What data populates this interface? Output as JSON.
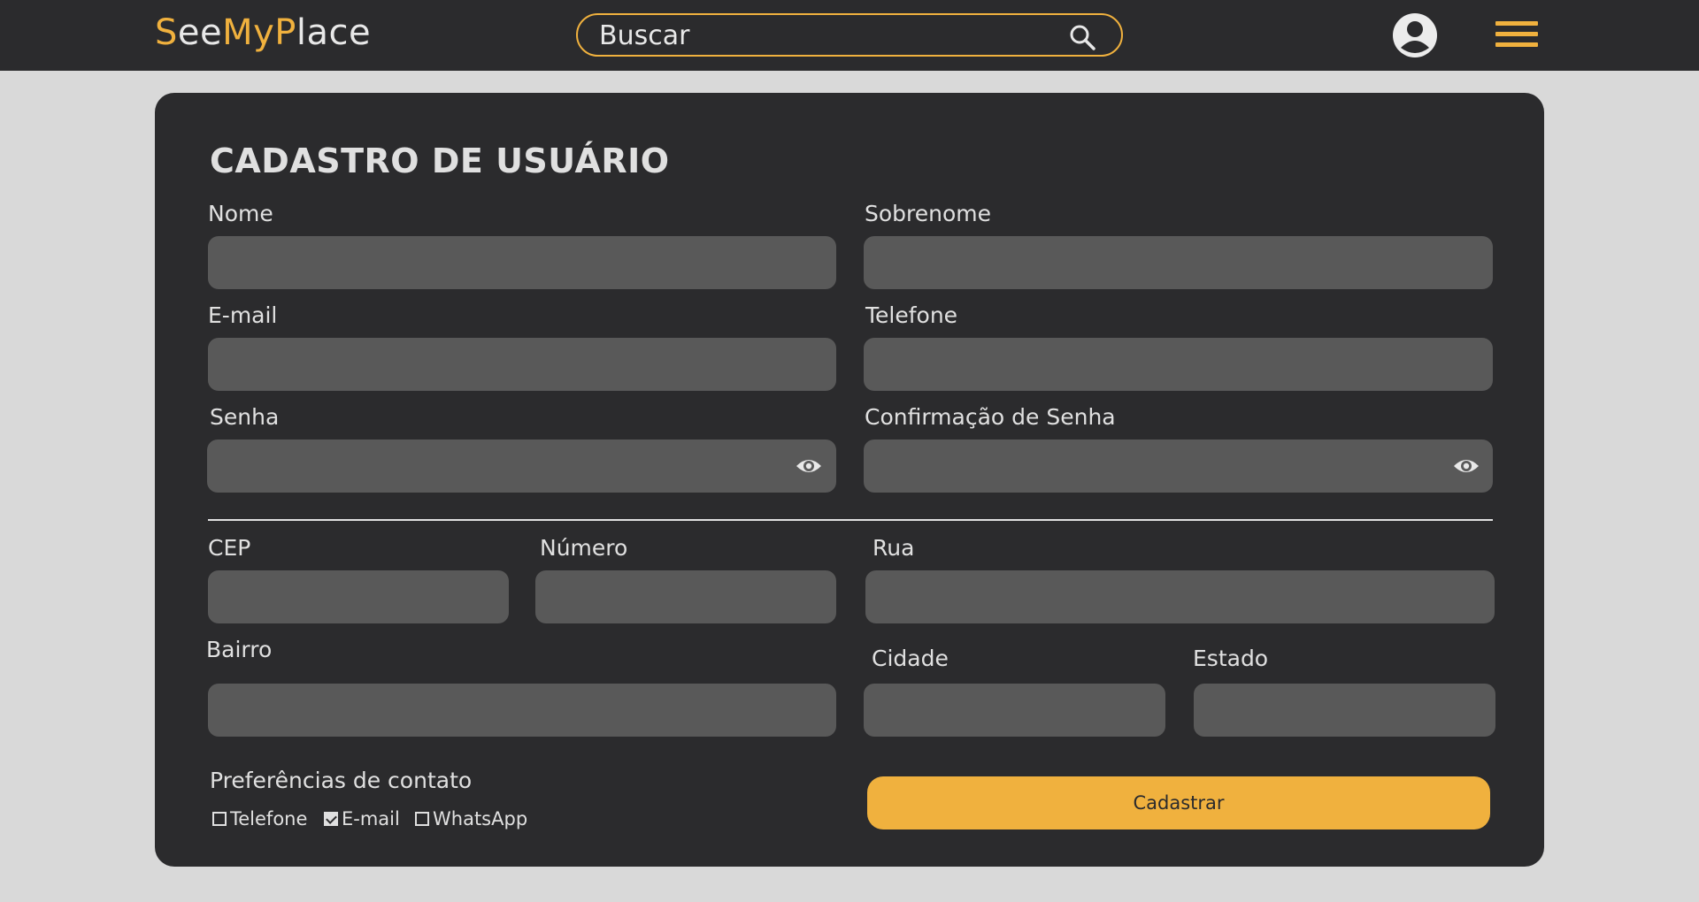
{
  "header": {
    "logo": {
      "part1": "S",
      "part2": "ee",
      "part3": "My",
      "part4": "P",
      "part5": "lace"
    },
    "search": {
      "placeholder": "Buscar",
      "icon": "search-icon"
    },
    "user_icon": "user-avatar-icon",
    "menu_icon": "hamburger-menu-icon"
  },
  "colors": {
    "accent": "#f0b13e",
    "card": "#2b2b2d",
    "field": "#595959",
    "page": "#d9d9d9"
  },
  "form": {
    "title": "CADASTRO DE USUÁRIO",
    "fields": {
      "nome": {
        "label": "Nome",
        "value": ""
      },
      "sobrenome": {
        "label": "Sobrenome",
        "value": ""
      },
      "email": {
        "label": "E-mail",
        "value": ""
      },
      "telefone": {
        "label": "Telefone",
        "value": ""
      },
      "senha": {
        "label": "Senha",
        "value": ""
      },
      "confirmacao": {
        "label": "Confirmação de Senha",
        "value": ""
      },
      "cep": {
        "label": "CEP",
        "value": ""
      },
      "numero": {
        "label": "Número",
        "value": ""
      },
      "rua": {
        "label": "Rua",
        "value": ""
      },
      "bairro": {
        "label": "Bairro",
        "value": ""
      },
      "cidade": {
        "label": "Cidade",
        "value": ""
      },
      "estado": {
        "label": "Estado",
        "value": ""
      }
    },
    "preferences": {
      "title": "Preferências de contato",
      "options": [
        {
          "label": "Telefone",
          "checked": false
        },
        {
          "label": "E-mail",
          "checked": true
        },
        {
          "label": "WhatsApp",
          "checked": false
        }
      ]
    },
    "submit_label": "Cadastrar"
  }
}
